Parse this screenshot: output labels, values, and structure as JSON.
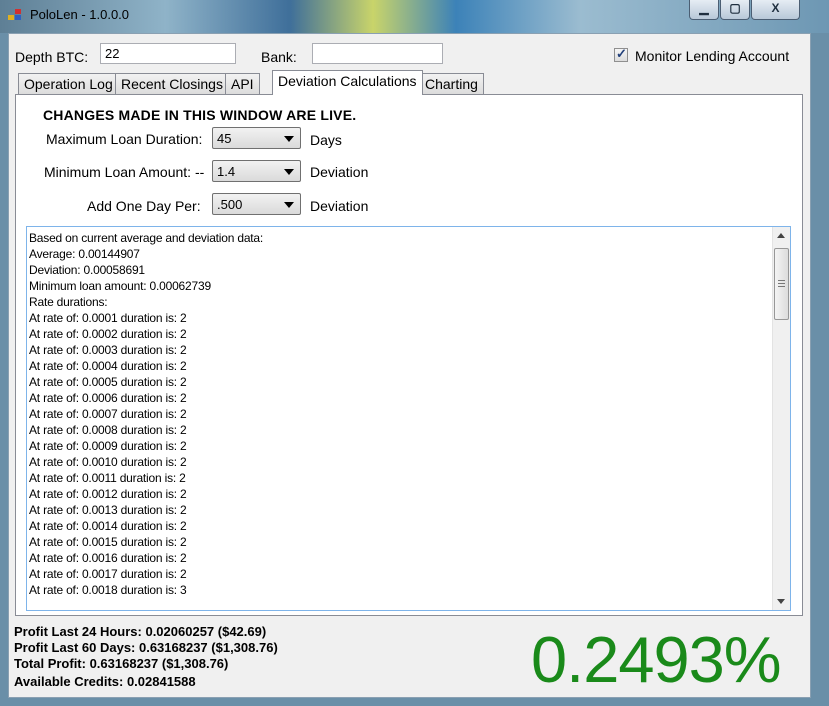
{
  "window": {
    "title": "PoloLen - 1.0.0.0",
    "min_glyph": "▁",
    "max_glyph": "▢",
    "close_glyph": "X"
  },
  "top": {
    "depth_label": "Depth BTC:",
    "depth_value": "22",
    "bank_label": "Bank:",
    "bank_value": "",
    "monitor_label": "Monitor Lending Account",
    "monitor_checked": true
  },
  "tabs": [
    "Operation Log",
    "Recent Closings",
    "API",
    "Deviation Calculations",
    "Charting"
  ],
  "active_tab": "Deviation Calculations",
  "deviation": {
    "warning": "CHANGES MADE IN THIS WINDOW ARE LIVE.",
    "max_duration_label": "Maximum Loan Duration:",
    "max_duration_value": "45",
    "max_duration_unit": "Days",
    "min_amount_label": "Minimum Loan Amount: --",
    "min_amount_value": "1.4",
    "min_amount_unit": "Deviation",
    "add_day_label": "Add One Day Per:",
    "add_day_value": ".500",
    "add_day_unit": "Deviation"
  },
  "log_lines": [
    "Based on current average and deviation data:",
    "Average: 0.00144907",
    "Deviation: 0.00058691",
    "Minimum loan amount: 0.00062739",
    "Rate durations:",
    "At rate of: 0.0001 duration is: 2",
    "At rate of: 0.0002 duration is: 2",
    "At rate of: 0.0003 duration is: 2",
    "At rate of: 0.0004 duration is: 2",
    "At rate of: 0.0005 duration is: 2",
    "At rate of: 0.0006 duration is: 2",
    "At rate of: 0.0007 duration is: 2",
    "At rate of: 0.0008 duration is: 2",
    "At rate of: 0.0009 duration is: 2",
    "At rate of: 0.0010 duration is: 2",
    "At rate of: 0.0011 duration is: 2",
    "At rate of: 0.0012 duration is: 2",
    "At rate of: 0.0013 duration is: 2",
    "At rate of: 0.0014 duration is: 2",
    "At rate of: 0.0015 duration is: 2",
    "At rate of: 0.0016 duration is: 2",
    "At rate of: 0.0017 duration is: 2",
    "At rate of: 0.0018 duration is: 3"
  ],
  "stats": {
    "profit_24h": "Profit Last 24 Hours:  0.02060257 ($42.69)",
    "profit_60d": "Profit Last 60 Days: 0.63168237 ($1,308.76)",
    "total_profit": "Total Profit: 0.63168237 ($1,308.76)",
    "available_credits": "Available Credits:  0.02841588"
  },
  "rate_display": "0.2493%",
  "colors": {
    "rate_green": "#1a8a1a",
    "log_border": "#7eb4ea"
  }
}
